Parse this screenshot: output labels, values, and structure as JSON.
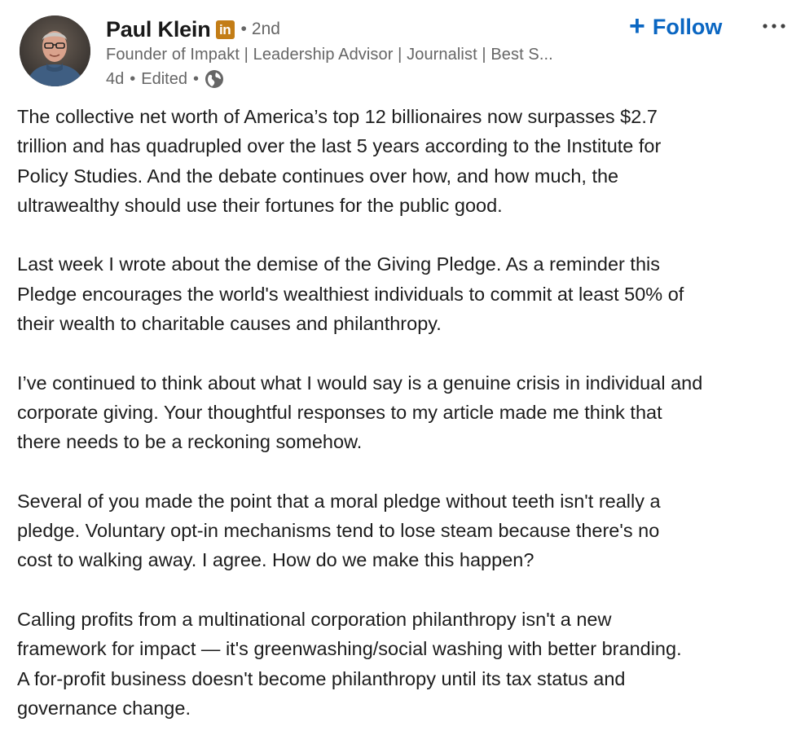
{
  "author": {
    "name": "Paul Klein",
    "badge_text": "in",
    "degree": "2nd",
    "headline": "Founder of Impakt | Leadership Advisor | Journalist | Best S...",
    "time": "4d",
    "edited": "Edited"
  },
  "actions": {
    "follow_icon": "+",
    "follow_label": "Follow",
    "more_label": "···"
  },
  "icons": {
    "avatar": "profile-photo",
    "badge": "linkedin-premium-badge",
    "visibility": "globe-icon"
  },
  "colors": {
    "accent": "#0a66c2",
    "badge": "#c37d16",
    "muted_text": "#666666"
  },
  "post": {
    "paragraphs": [
      "The collective net worth of America’s top 12 billionaires now surpasses $2.7\ntrillion and has quadrupled over the last 5 years according to the Institute for\nPolicy Studies. And the debate continues over how, and how much, the\nultrawealthy should use their fortunes for the public good.",
      "Last week I wrote about the demise of the Giving Pledge. As a reminder this\nPledge encourages the world's wealthiest individuals to commit at least 50% of\ntheir wealth to charitable causes and philanthropy.",
      "I’ve continued to think about what I would say is a genuine crisis in individual and\ncorporate giving. Your thoughtful responses to my article made me think that\nthere needs to be a reckoning somehow.",
      "Several of you made the point that a moral pledge without teeth isn't really a\npledge. Voluntary opt-in mechanisms tend to lose steam because there's no\ncost to walking away. I agree. How do we make this happen?",
      "Calling profits from a multinational corporation philanthropy isn't a new\nframework for impact — it's greenwashing/social washing with better branding.\nA for-profit business doesn't become philanthropy until its tax status and\ngovernance change."
    ]
  }
}
